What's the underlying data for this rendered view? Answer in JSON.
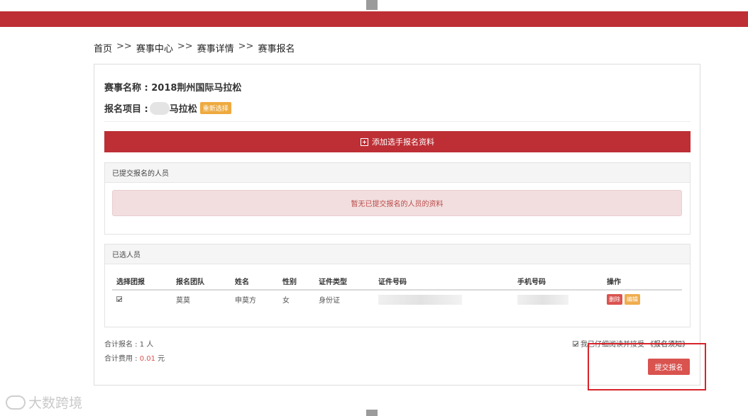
{
  "breadcrumb": {
    "items": [
      "首页",
      "赛事中心",
      "赛事详情",
      "赛事报名"
    ],
    "separator": ">>"
  },
  "event": {
    "name_label": "赛事名称 : 2018荆州国际马拉松",
    "item_label": "报名项目 :",
    "item_value": "马拉松",
    "reselect_label": "重新选择"
  },
  "add_button": {
    "label": "添加选手报名资料",
    "icon": "plus-square-icon"
  },
  "submitted_panel": {
    "title": "已提交报名的人员",
    "empty_message": "暂无已提交报名的人员的资料"
  },
  "selected_panel": {
    "title": "已选人员",
    "columns": [
      "选择团报",
      "报名团队",
      "姓名",
      "性别",
      "证件类型",
      "证件号码",
      "手机号码",
      "操作"
    ],
    "rows": [
      {
        "checked": true,
        "team": "莫莫",
        "name": "申莫方",
        "gender": "女",
        "id_type": "身份证",
        "id_number": "",
        "phone": ""
      }
    ],
    "delete_label": "删除",
    "edit_label": "编辑"
  },
  "totals": {
    "count_label": "合计报名 : 1 人",
    "fee_prefix": "合计费用 : ",
    "fee_value": "0.01",
    "fee_unit": " 元"
  },
  "agreement": {
    "text": "我已仔细阅读并接受",
    "link": "《报名须知》",
    "checked": true
  },
  "submit_label": "提交报名",
  "watermark": "大数跨境",
  "colors": {
    "brand_red": "#bd2f35",
    "danger": "#d9534f",
    "warning": "#f0ad4e",
    "alert_bg": "#f2dede"
  }
}
